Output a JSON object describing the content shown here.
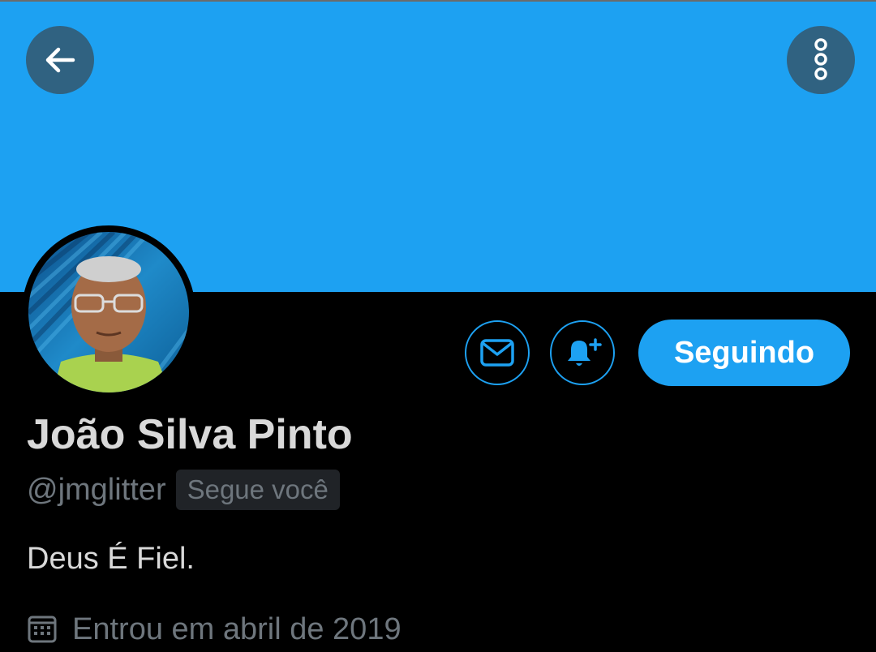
{
  "profile": {
    "display_name": "João Silva Pinto",
    "handle": "@jmglitter",
    "follows_you_badge": "Segue você",
    "bio": "Deus É Fiel.",
    "joined": "Entrou em abril de 2019"
  },
  "actions": {
    "follow_button_label": "Seguindo",
    "message_icon": "envelope-icon",
    "notify_icon": "bell-plus-icon"
  },
  "header": {
    "back_icon": "arrow-left-icon",
    "more_icon": "more-vertical-icon"
  },
  "colors": {
    "accent": "#1DA1F2",
    "background": "#000000",
    "primary_text": "#D9D9D9",
    "secondary_text": "#6E767D"
  }
}
